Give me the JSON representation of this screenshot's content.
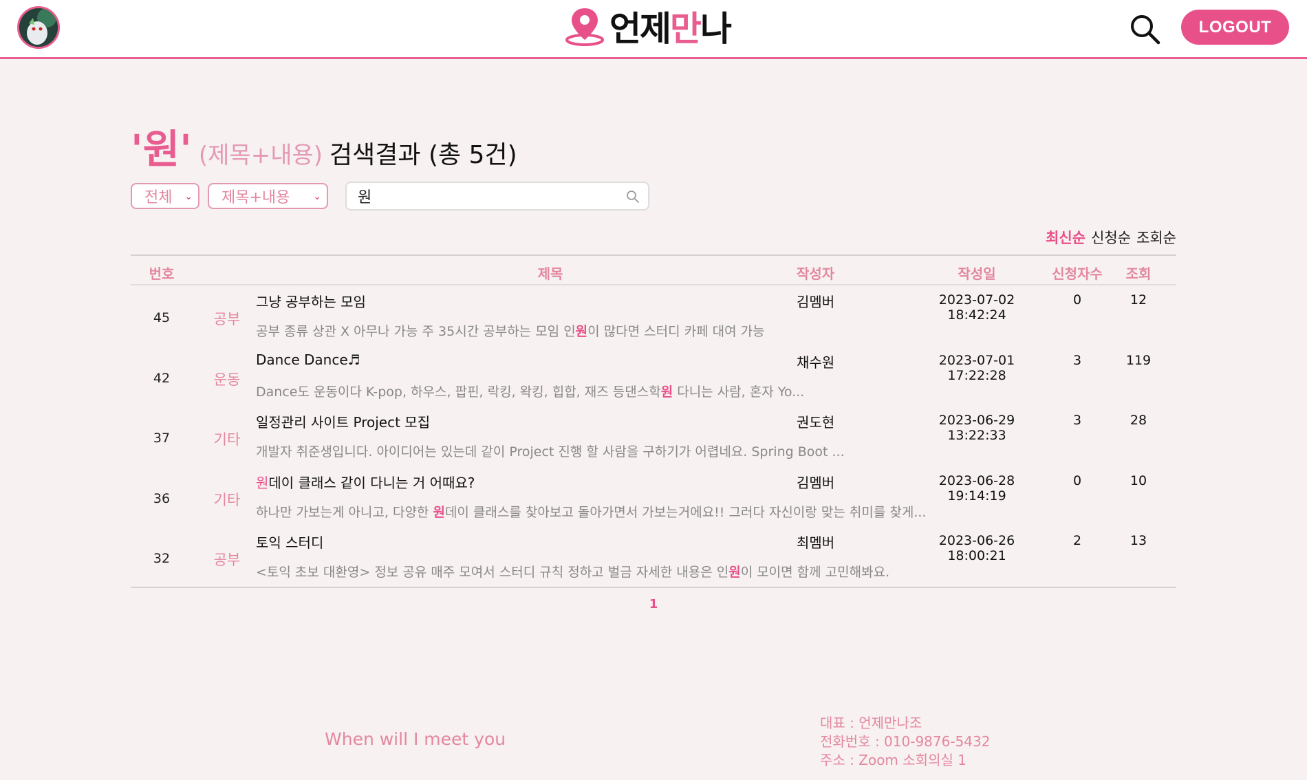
{
  "header": {
    "logo_text_1": "언제",
    "logo_text_2": "만",
    "logo_text_3": "나",
    "logout_label": "LOGOUT"
  },
  "search_result": {
    "keyword": "'원'",
    "search_type": "(제목+내용)",
    "label": "검색결과 (총 5건)"
  },
  "filters": {
    "category_selected": "전체",
    "type_selected": "제목+내용",
    "search_value": "원"
  },
  "sort": {
    "options": [
      "최신순",
      "신청순",
      "조회순"
    ],
    "active": "최신순"
  },
  "table": {
    "headers": {
      "num": "번호",
      "title": "제목",
      "author": "작성자",
      "date": "작성일",
      "apply": "신청자수",
      "views": "조회"
    },
    "rows": [
      {
        "num": "45",
        "category": "공부",
        "title": "그냥 공부하는 모임",
        "preview_pre": " 공부 종류 상관 X  아무나 가능  주 35시간 공부하는 모임  인",
        "preview_hl": "원",
        "preview_post": "이 많다면 스터디 카페 대여 가능",
        "author": "김멤버",
        "date": "2023-07-02 18:42:24",
        "apply": "0",
        "views": "12"
      },
      {
        "num": "42",
        "category": "운동",
        "title": "Dance Dance♬",
        "preview_pre": "  Dance도 운동이다  K-pop, 하우스, 팝핀, 락킹, 왁킹, 힙합, 재즈 등댄스학",
        "preview_hl": "원",
        "preview_post": " 다니는 사람, 혼자 Yo...",
        "author": "채수원",
        "date": "2023-07-01 17:22:28",
        "apply": "3",
        "views": "119"
      },
      {
        "num": "37",
        "category": "기타",
        "title": "일정관리 사이트 Project 모집",
        "preview_pre": "개발자 취준생입니다. 아이디어는 있는데 같이 Project 진행 할 사람을 구하기가 어렵네요. Spring Boot ...",
        "preview_hl": "",
        "preview_post": "",
        "author": "권도현",
        "date": "2023-06-29 13:22:33",
        "apply": "3",
        "views": "28"
      },
      {
        "num": "36",
        "category": "기타",
        "title_hl": "원",
        "title": "데이 클래스 같이 다니는 거 어때요?",
        "preview_pre": "하나만 가보는게 아니고, 다양한 ",
        "preview_hl": "원",
        "preview_post": "데이 클래스를 찾아보고 돌아가면서 가보는거에요!! 그러다 자신이랑 맞는 취미를 찾게...",
        "author": "김멤버",
        "date": "2023-06-28 19:14:19",
        "apply": "0",
        "views": "10"
      },
      {
        "num": "32",
        "category": "공부",
        "title": "토익 스터디",
        "preview_pre": "<토익 초보 대환영> 정보 공유 매주 모여서 스터디 규칙 정하고 벌금 자세한 내용은 인",
        "preview_hl": "원",
        "preview_post": "이 모이면 함께 고민해봐요.",
        "author": "최멤버",
        "date": "2023-06-26 18:00:21",
        "apply": "2",
        "views": "13"
      }
    ]
  },
  "pagination": {
    "current": "1"
  },
  "footer": {
    "slogan": "When will I meet you",
    "rep": "대표 : 언제만나조",
    "phone": "전화번호 : 010-9876-5432",
    "address": "주소 : Zoom 소회의실 1"
  },
  "colors": {
    "accent": "#e8508a",
    "muted_pink": "#e3879f",
    "background": "#f8f1f1"
  },
  "icons": {
    "search": "search-icon",
    "avatar": "avatar",
    "location_pin": "location-pin-icon"
  }
}
